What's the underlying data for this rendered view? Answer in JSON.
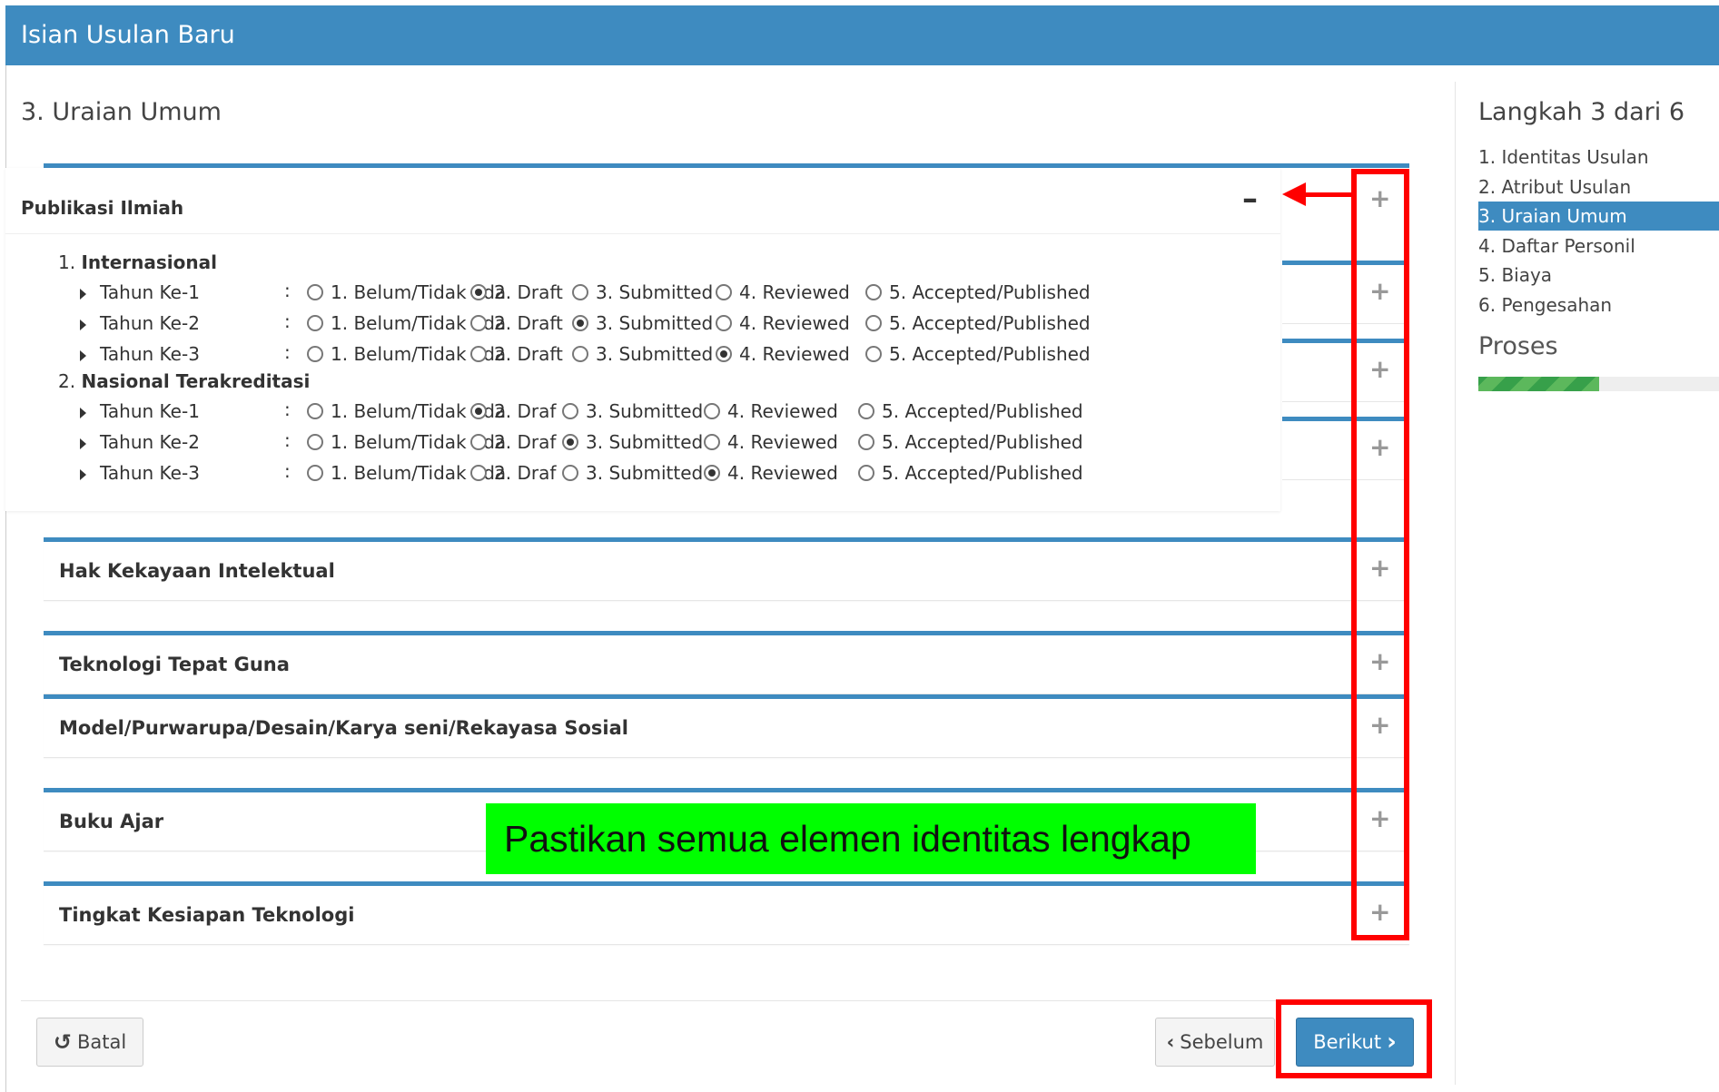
{
  "header": {
    "title": "Isian Usulan Baru"
  },
  "section_title": "3. Uraian Umum",
  "expanded_panel": {
    "title": "Publikasi Ilmiah",
    "collapse_symbol": "–",
    "groups": [
      {
        "title_num": "1.",
        "title": "Internasional",
        "rows": [
          {
            "label": "Tahun Ke-1",
            "options": [
              "1. Belum/Tidak ada",
              "2. Draft",
              "3. Submitted",
              "4. Reviewed",
              "5. Accepted/Published"
            ],
            "selected": 1
          },
          {
            "label": "Tahun Ke-2",
            "options": [
              "1. Belum/Tidak ada",
              "2. Draft",
              "3. Submitted",
              "4. Reviewed",
              "5. Accepted/Published"
            ],
            "selected": 2
          },
          {
            "label": "Tahun Ke-3",
            "options": [
              "1. Belum/Tidak ada",
              "2. Draft",
              "3. Submitted",
              "4. Reviewed",
              "5. Accepted/Published"
            ],
            "selected": 3
          }
        ]
      },
      {
        "title_num": "2.",
        "title": "Nasional Terakreditasi",
        "rows": [
          {
            "label": "Tahun Ke-1",
            "options": [
              "1. Belum/Tidak ada",
              "2. Draf",
              "3. Submitted",
              "4. Reviewed",
              "5. Accepted/Published"
            ],
            "selected": 1
          },
          {
            "label": "Tahun Ke-2",
            "options": [
              "1. Belum/Tidak ada",
              "2. Draf",
              "3. Submitted",
              "4. Reviewed",
              "5. Accepted/Published"
            ],
            "selected": 2
          },
          {
            "label": "Tahun Ke-3",
            "options": [
              "1. Belum/Tidak ada",
              "2. Draf",
              "3. Submitted",
              "4. Reviewed",
              "5. Accepted/Published"
            ],
            "selected": 3
          }
        ]
      }
    ]
  },
  "panels": [
    {
      "title": "Hak Kekayaan Intelektual"
    },
    {
      "title": "Teknologi Tepat Guna"
    },
    {
      "title": "Model/Purwarupa/Desain/Karya seni/Rekayasa Sosial"
    },
    {
      "title": "Buku Ajar"
    },
    {
      "title": "Tingkat Kesiapan Teknologi"
    }
  ],
  "expand_symbol": "+",
  "sidebar": {
    "title": "Langkah 3 dari 6",
    "steps": [
      "1. Identitas Usulan",
      "2. Atribut Usulan",
      "3. Uraian Umum",
      "4. Daftar Personil",
      "5. Biaya",
      "6. Pengesahan"
    ],
    "active_step": 2,
    "proses_label": "Proses",
    "progress_fraction": 0.5
  },
  "footer": {
    "cancel_label": "Batal",
    "prev_label": "Sebelum",
    "next_label": "Berikut"
  },
  "annotation": {
    "callout_text": "Pastikan semua elemen identitas lengkap"
  },
  "colors": {
    "header": "#3e8bc0",
    "annotation_red": "#ff0000",
    "callout_green": "#00ff00",
    "progress": "#5cb85c"
  }
}
